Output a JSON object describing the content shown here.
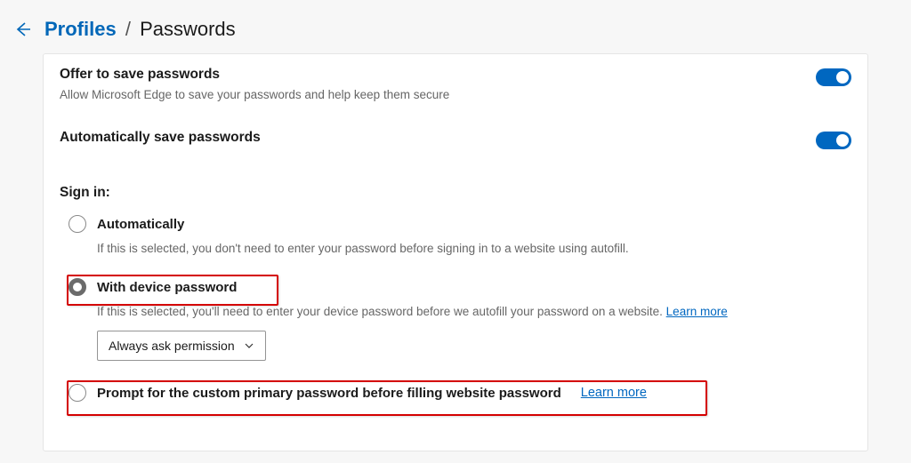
{
  "breadcrumb": {
    "root": "Profiles",
    "separator": "/",
    "current": "Passwords"
  },
  "offer_save": {
    "title": "Offer to save passwords",
    "desc": "Allow Microsoft Edge to save your passwords and help keep them secure"
  },
  "auto_save": {
    "title": "Automatically save passwords"
  },
  "sign_in": {
    "header": "Sign in:",
    "options": {
      "auto": {
        "label": "Automatically",
        "desc": "If this is selected, you don't need to enter your password before signing in to a website using autofill."
      },
      "device": {
        "label": "With device password",
        "desc": "If this is selected, you'll need to enter your device password before we autofill your password on a website. ",
        "learn_more": "Learn more",
        "dropdown": "Always ask permission"
      },
      "custom": {
        "label": "Prompt for the custom primary password before filling website password",
        "learn_more": "Learn more"
      }
    }
  }
}
